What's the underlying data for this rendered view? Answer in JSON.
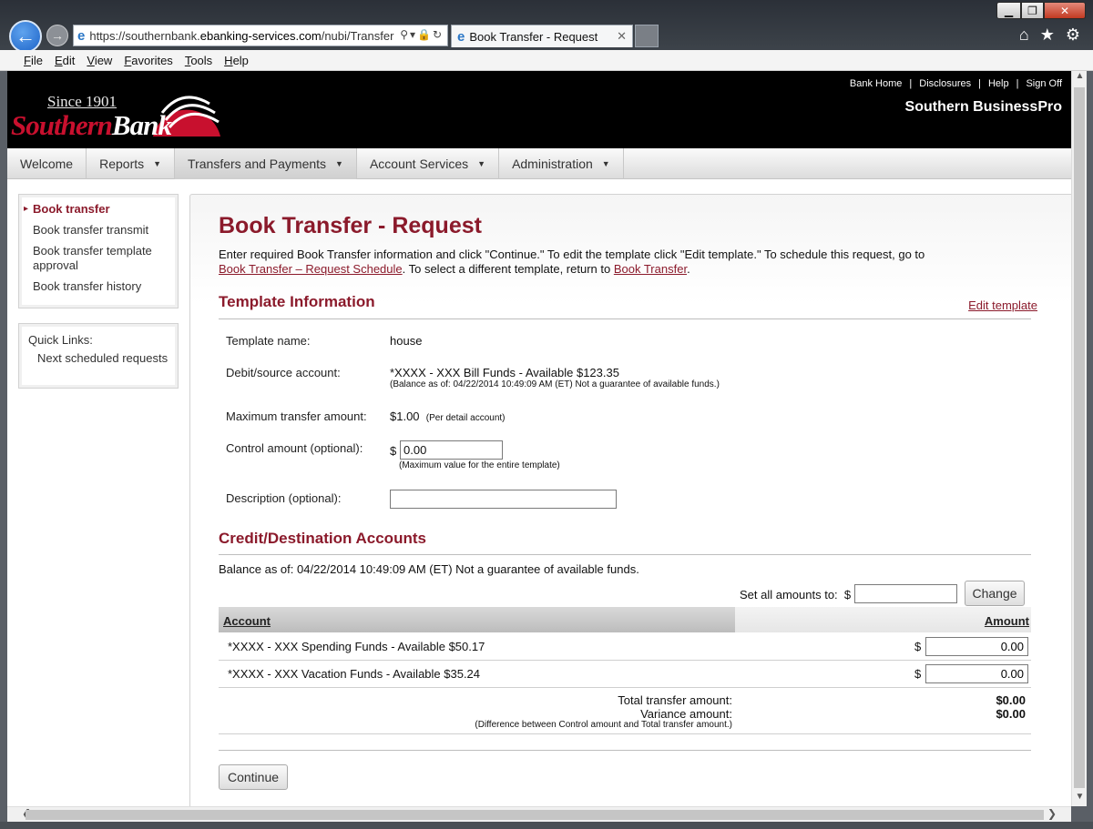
{
  "browser": {
    "url_prefix": "https://southernbank.",
    "url_domain": "ebanking-services.com",
    "url_path": "/nubi/Transfer",
    "tab_title": "Book Transfer - Request",
    "menu": [
      "File",
      "Edit",
      "View",
      "Favorites",
      "Tools",
      "Help"
    ]
  },
  "header": {
    "logo_since": "Since 1901",
    "logo_name_1": "Southern",
    "logo_name_2": "Bank",
    "links": [
      "Bank Home",
      "Disclosures",
      "Help",
      "Sign Off"
    ],
    "app_name": "Southern BusinessPro"
  },
  "nav": {
    "items": [
      {
        "label": "Welcome"
      },
      {
        "label": "Reports"
      },
      {
        "label": "Transfers and Payments"
      },
      {
        "label": "Account Services"
      },
      {
        "label": "Administration"
      }
    ]
  },
  "sidebar": {
    "items": [
      {
        "label": "Book transfer"
      },
      {
        "label": "Book transfer transmit"
      },
      {
        "label": "Book transfer template approval"
      },
      {
        "label": "Book transfer history"
      }
    ],
    "quick_links_title": "Quick Links:",
    "quick_links": [
      {
        "label": "Next scheduled requests"
      }
    ]
  },
  "page": {
    "title": "Book Transfer - Request",
    "intro_1": "Enter required Book Transfer information and click \"Continue.\" To edit the template click \"Edit template.\" To schedule this request, go to",
    "intro_link_1": "Book Transfer – Request Schedule",
    "intro_2": ". To select a different template, return to ",
    "intro_link_2": "Book Transfer",
    "intro_3": "."
  },
  "template": {
    "section_title": "Template Information",
    "edit_link": "Edit template",
    "name_label": "Template name:",
    "name_value": "house",
    "debit_label": "Debit/source account:",
    "debit_value": "*XXXX - XXX Bill Funds - Available $123.35",
    "debit_note": "(Balance as of: 04/22/2014 10:49:09 AM (ET) Not a guarantee of available funds.)",
    "max_label": "Maximum transfer amount:",
    "max_value": "$1.00",
    "max_note": "(Per detail account)",
    "control_label": "Control amount (optional):",
    "control_currency": "$",
    "control_value": "0.00",
    "control_note": "(Maximum value for the entire template)",
    "desc_label": "Description (optional):",
    "desc_value": ""
  },
  "credit": {
    "section_title": "Credit/Destination Accounts",
    "balance_line": "Balance as of: 04/22/2014 10:49:09 AM (ET) Not a guarantee of available funds.",
    "set_all_label": "Set all amounts to:",
    "set_all_currency": "$",
    "set_all_value": "",
    "change_button": "Change",
    "columns": {
      "account": "Account",
      "amount": "Amount"
    },
    "rows": [
      {
        "account": "*XXXX - XXX Spending Funds - Available $50.17",
        "currency": "$",
        "amount": "0.00"
      },
      {
        "account": "*XXXX - XXX Vacation Funds - Available $35.24",
        "currency": "$",
        "amount": "0.00"
      }
    ],
    "total_label": "Total transfer amount:",
    "total_value": "$0.00",
    "variance_label": "Variance amount:",
    "variance_value": "$0.00",
    "variance_note": "(Difference between Control amount and Total transfer amount.)"
  },
  "actions": {
    "continue_button": "Continue"
  },
  "colors": {
    "brand": "#8b1a2b",
    "header_bg": "#000000",
    "logo_red": "#c8102e"
  }
}
